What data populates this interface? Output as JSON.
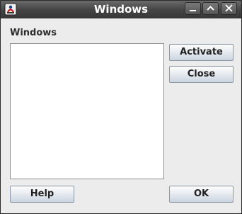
{
  "window": {
    "title": "Windows"
  },
  "titlebar_buttons": [
    "minimize-icon",
    "maximize-icon",
    "close-icon"
  ],
  "main": {
    "section_label": "Windows",
    "windows_list": []
  },
  "buttons": {
    "activate": "Activate",
    "close": "Close",
    "help": "Help",
    "ok": "OK"
  },
  "colors": {
    "titlebar": "#444444",
    "background": "#ececec",
    "button_border": "#8b98a6"
  }
}
